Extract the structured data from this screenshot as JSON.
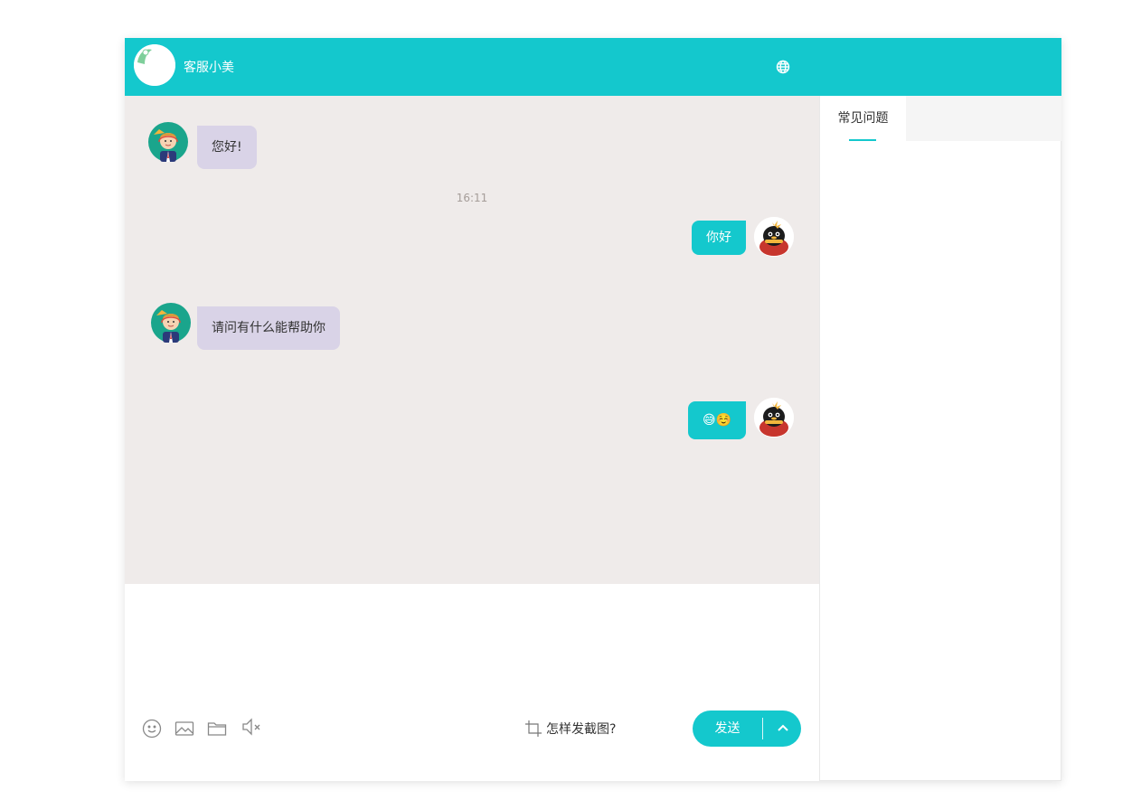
{
  "theme": {
    "accent": "#14c8cd",
    "agent_bubble": "#d9d3e7",
    "chat_bg": "#efebea"
  },
  "header": {
    "title": "客服小美",
    "avatar_icon": "agent-logo-icon",
    "language_icon": "globe-icon"
  },
  "messages": [
    {
      "from": "agent",
      "text": "您好!"
    },
    {
      "type": "time",
      "text": "16:11"
    },
    {
      "from": "user",
      "text": "你好"
    },
    {
      "from": "agent",
      "text": "请问有什么能帮助你"
    },
    {
      "from": "user",
      "text": "😅☺️"
    }
  ],
  "toolbar": {
    "icons": [
      "emoji-icon",
      "image-icon",
      "folder-icon",
      "sound-mute-icon"
    ],
    "screenshot_hint": "怎样发截图?",
    "send_label": "发送"
  },
  "sidebar": {
    "tabs": [
      {
        "label": "常见问题",
        "active": true
      }
    ]
  }
}
